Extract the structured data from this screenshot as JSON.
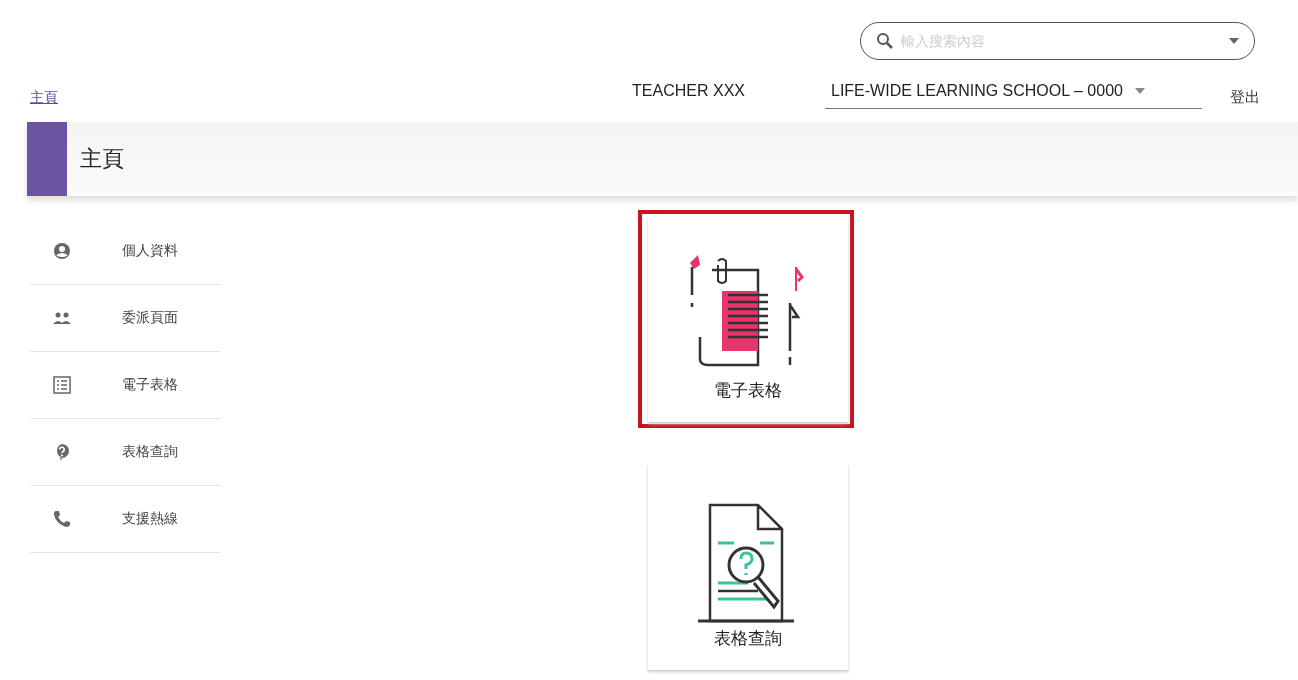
{
  "search": {
    "placeholder": "輸入搜索內容"
  },
  "breadcrumb": "主頁",
  "user": "TEACHER XXX",
  "school_select": {
    "value": "LIFE-WIDE LEARNING SCHOOL – 0000"
  },
  "logout": "登出",
  "page_title": "主頁",
  "sidebar": {
    "items": [
      {
        "label": "個人資料",
        "kind": "person"
      },
      {
        "label": "委派頁面",
        "kind": "people"
      },
      {
        "label": "電子表格",
        "kind": "form"
      },
      {
        "label": "表格查詢",
        "kind": "help"
      },
      {
        "label": "支援熱線",
        "kind": "phone"
      }
    ]
  },
  "tiles": [
    {
      "label": "電子表格",
      "kind": "form",
      "highlighted": true
    },
    {
      "label": "表格查詢",
      "kind": "query",
      "highlighted": false
    }
  ]
}
